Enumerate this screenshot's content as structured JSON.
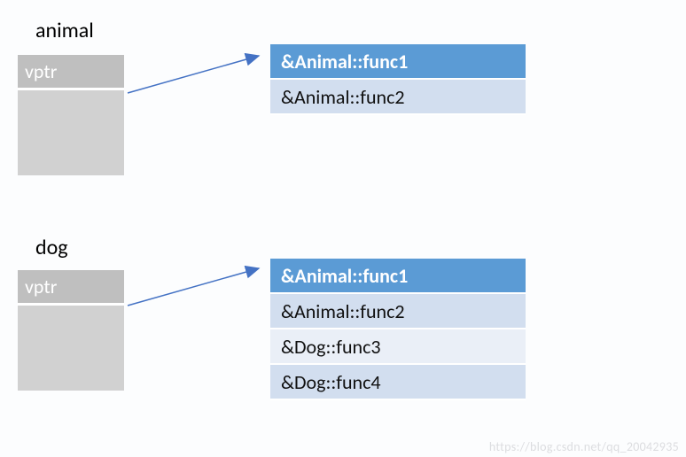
{
  "diagram1": {
    "title": "animal",
    "vptr_label": "vptr",
    "vtable": {
      "rows": [
        "&Animal::func1",
        "&Animal::func2"
      ]
    }
  },
  "diagram2": {
    "title": "dog",
    "vptr_label": "vptr",
    "vtable": {
      "rows": [
        "&Animal::func1",
        "&Animal::func2",
        "&Dog::func3",
        "&Dog::func4"
      ]
    }
  },
  "watermark": "https://blog.csdn.net/qq_20042935",
  "colors": {
    "header_bg": "#5b9bd5",
    "alt_bg": "#d2deef",
    "alt2_bg": "#eaeff7",
    "obj_bg": "#d1d1d1",
    "vptr_bg": "#bfbfbf",
    "arrow": "#4472c4"
  }
}
